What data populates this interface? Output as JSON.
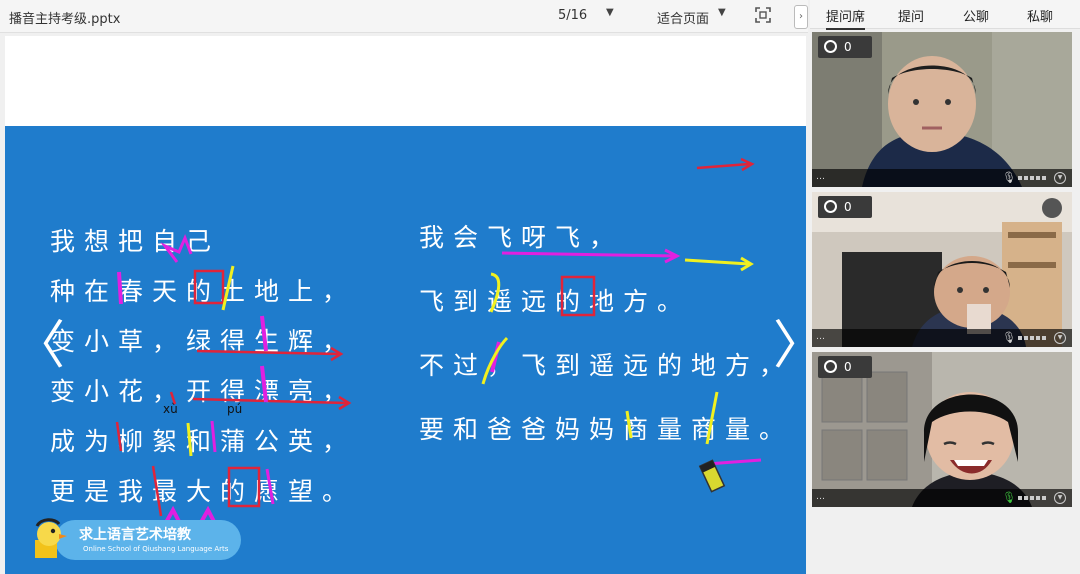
{
  "toolbar": {
    "filename": "播音主持考级.pptx",
    "page_indicator": "5/16",
    "zoom_mode": "适合页面",
    "dropdown_icon": "caret-down-icon",
    "fullscreen_icon": "fullscreen-icon",
    "collapse_icon": "chevron-right-icon"
  },
  "slide": {
    "left_poem": [
      "我想把自己",
      "种在春天的土地上，",
      "变小草，绿得生辉，",
      "变小花，开得漂亮，",
      "成为柳絮和蒲公英，",
      "更是我最大的愿望。"
    ],
    "right_poem": [
      "我会飞呀飞，",
      "飞到遥远的地方。",
      "不过，飞到遥远的地方，",
      "要和爸爸妈妈商量商量。"
    ],
    "pinyin": [
      "xù",
      "pú"
    ],
    "prev_arrow": "〈",
    "next_arrow": "〉",
    "logo": {
      "title": "求上语言艺术培教",
      "subtitle": "Online School of Qiushang Language Arts"
    }
  },
  "panel": {
    "tabs": [
      "提问席",
      "提问",
      "公聊",
      "私聊"
    ],
    "active_tab": "提问席",
    "videos": [
      {
        "badge_count": "0",
        "name": "…",
        "mic": "mic-muted-icon"
      },
      {
        "badge_count": "0",
        "name": "…",
        "mic": "mic-muted-icon"
      },
      {
        "badge_count": "0",
        "name": "…",
        "mic": "mic-active-icon"
      }
    ]
  },
  "colors": {
    "slide_blue": "#1f7ccc",
    "annotation_red": "#e0243a",
    "annotation_magenta": "#e020e0",
    "annotation_yellow": "#f0f020"
  }
}
